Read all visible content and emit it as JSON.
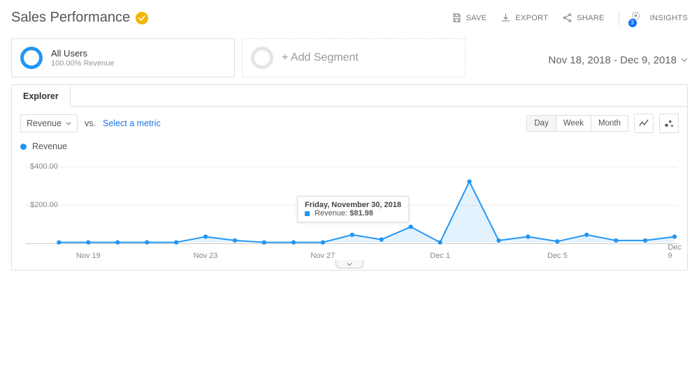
{
  "header": {
    "title": "Sales Performance",
    "verified": true,
    "save_label": "SAVE",
    "export_label": "EXPORT",
    "share_label": "SHARE",
    "insights_label": "INSIGHTS",
    "insights_badge": "3"
  },
  "segments": {
    "primary": {
      "title": "All Users",
      "subtitle": "100.00% Revenue"
    },
    "add_label": "+ Add Segment"
  },
  "date_range": "Nov 18, 2018 - Dec 9, 2018",
  "tabs": {
    "explorer": "Explorer"
  },
  "metric": {
    "primary": "Revenue",
    "vs_label": "vs.",
    "secondary_prompt": "Select a metric"
  },
  "granularity": {
    "day": "Day",
    "week": "Week",
    "month": "Month",
    "active": "Day"
  },
  "legend": {
    "series": "Revenue"
  },
  "tooltip": {
    "date": "Friday, November 30, 2018",
    "series": "Revenue",
    "value": "$81.98"
  },
  "chart_data": {
    "type": "line",
    "title": "Revenue",
    "xlabel": "",
    "ylabel": "",
    "ylim": [
      0,
      450
    ],
    "y_ticks": [
      "$400.00",
      "$200.00"
    ],
    "x_ticks": [
      "Nov 19",
      "Nov 23",
      "Nov 27",
      "Dec 1",
      "Dec 5",
      "Dec 9"
    ],
    "categories": [
      "Nov 18",
      "Nov 19",
      "Nov 20",
      "Nov 21",
      "Nov 22",
      "Nov 23",
      "Nov 24",
      "Nov 25",
      "Nov 26",
      "Nov 27",
      "Nov 28",
      "Nov 29",
      "Nov 30",
      "Dec 1",
      "Dec 2",
      "Dec 3",
      "Dec 4",
      "Dec 5",
      "Dec 6",
      "Dec 7",
      "Dec 8",
      "Dec 9"
    ],
    "values": [
      0,
      0,
      0,
      0,
      0,
      30,
      10,
      0,
      0,
      0,
      40,
      15,
      81.98,
      0,
      320,
      10,
      30,
      5,
      40,
      10,
      10,
      30
    ]
  }
}
